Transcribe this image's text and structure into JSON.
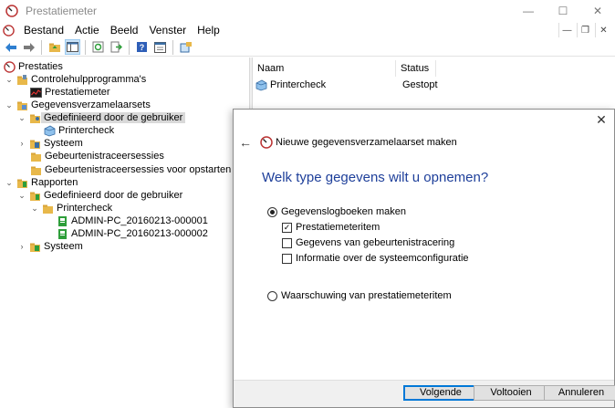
{
  "window": {
    "title": "Prestatiemeter",
    "minimize": "—",
    "maximize": "☐",
    "close": "✕"
  },
  "menu": {
    "items": [
      "Bestand",
      "Actie",
      "Beeld",
      "Venster",
      "Help"
    ],
    "mdi_minimize": "—",
    "mdi_restore": "❐",
    "mdi_close": "✕"
  },
  "toolbar": {
    "buttons": [
      "back-icon",
      "forward-icon",
      "folder-up-icon",
      "console-tree-icon",
      "refresh-icon",
      "export-icon",
      "help-icon",
      "properties-icon",
      "new-window-icon"
    ]
  },
  "tree": {
    "root": "Prestaties",
    "monitoring_tools": "Controlehulpprogramma's",
    "performance_monitor": "Prestatiemeter",
    "data_collector_sets": "Gegevensverzamelaarsets",
    "user_defined": "Gedefinieerd door de gebruiker",
    "printercheck": "Printercheck",
    "system": "Systeem",
    "event_trace_sessions": "Gebeurtenistraceersessies",
    "startup_event_trace": "Gebeurtenistraceersessies voor opstarten",
    "reports": "Rapporten",
    "reports_user_defined": "Gedefinieerd door de gebruiker",
    "reports_printercheck": "Printercheck",
    "report_1": "ADMIN-PC_20160213-000001",
    "report_2": "ADMIN-PC_20160213-000002",
    "reports_system": "Systeem"
  },
  "list": {
    "columns": [
      "Naam",
      "Status"
    ],
    "rows": [
      {
        "name": "Printercheck",
        "status": "Gestopt"
      }
    ]
  },
  "dialog": {
    "close": "✕",
    "back": "←",
    "title": "Nieuwe gegevensverzamelaarset maken",
    "heading": "Welk type gegevens wilt u opnemen?",
    "option_logs": "Gegevenslogboeken maken",
    "check_counters": "Prestatiemeteritem",
    "check_trace": "Gegevens van gebeurtenistracering",
    "check_sysconfig": "Informatie over de systeemconfiguratie",
    "option_alert": "Waarschuwing van prestatiemeteritem",
    "selected_option": "logs",
    "checked": {
      "counters": true,
      "trace": false,
      "sysconfig": false
    },
    "buttons": {
      "next": "Volgende",
      "finish": "Voltooien",
      "cancel": "Annuleren"
    }
  },
  "colors": {
    "heading_blue": "#1e3f9a",
    "default_button_border": "#0078d7",
    "report_green": "#2e9e3a",
    "folder_yellow": "#e8b84a"
  }
}
